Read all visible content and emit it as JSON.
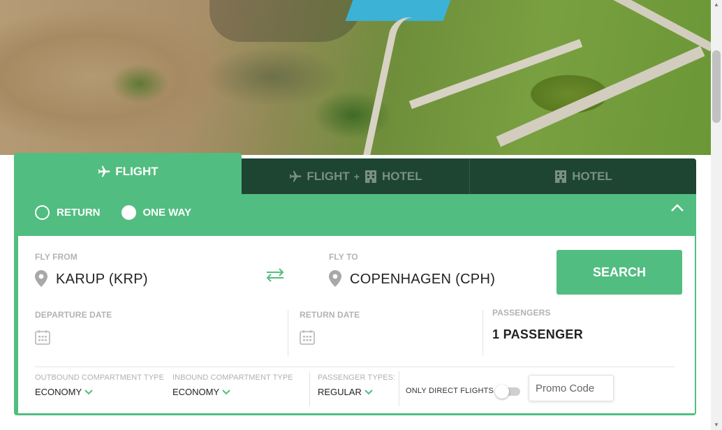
{
  "tabs": {
    "flight": "FLIGHT",
    "flight_hotel_a": "FLIGHT",
    "flight_hotel_plus": "+",
    "flight_hotel_b": "HOTEL",
    "hotel": "HOTEL",
    "active": "flight"
  },
  "trip_type": {
    "return_label": "RETURN",
    "one_way_label": "ONE WAY",
    "selected": "one_way"
  },
  "form": {
    "fly_from_label": "FLY FROM",
    "fly_from_value": "KARUP (KRP)",
    "fly_to_label": "FLY TO",
    "fly_to_value": "COPENHAGEN (CPH)",
    "search_label": "SEARCH",
    "departure_label": "DEPARTURE DATE",
    "return_label": "RETURN DATE",
    "passengers_label": "PASSENGERS",
    "passengers_value": "1 PASSENGER",
    "outbound_label": "OUTBOUND COMPARTMENT TYPE",
    "outbound_value": "ECONOMY",
    "inbound_label": "INBOUND COMPARTMENT TYPE",
    "inbound_value": "ECONOMY",
    "passenger_types_label": "PASSENGER TYPES:",
    "passenger_types_value": "REGULAR",
    "direct_flights_label": "ONLY DIRECT FLIGHTS",
    "direct_flights_on": false,
    "promo_placeholder": "Promo Code"
  },
  "colors": {
    "accent": "#52bd80",
    "dark_tab": "#1e4532"
  },
  "icons": [
    "plane-icon",
    "hotel-icon",
    "map-pin-icon",
    "swap-icon",
    "calendar-icon",
    "chevron-down-icon",
    "chevron-up-icon"
  ]
}
